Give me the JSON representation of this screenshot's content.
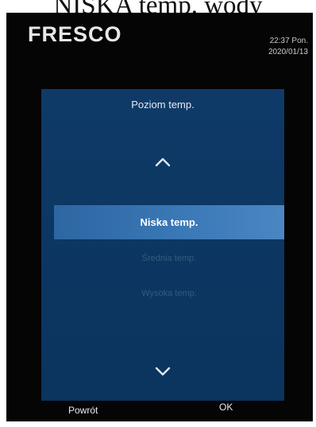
{
  "caption": "NISKA temp. wody",
  "device": {
    "logo": "FRESCO",
    "time": "22:37  Pon.",
    "date": "2020/01/13"
  },
  "menu": {
    "title": "Poziom temp.",
    "options": [
      {
        "label": "Niska temp.",
        "selected": true
      },
      {
        "label": "Średnia temp.",
        "selected": false
      },
      {
        "label": "Wysoka temp.",
        "selected": false
      }
    ],
    "up_icon": "chevron-up-icon",
    "down_icon": "chevron-down-icon"
  },
  "buttons": {
    "back": "Powrót",
    "ok": "OK"
  },
  "colors": {
    "panel": "#0c3762",
    "highlight": "#3a78b6",
    "device_frame": "#050506"
  }
}
